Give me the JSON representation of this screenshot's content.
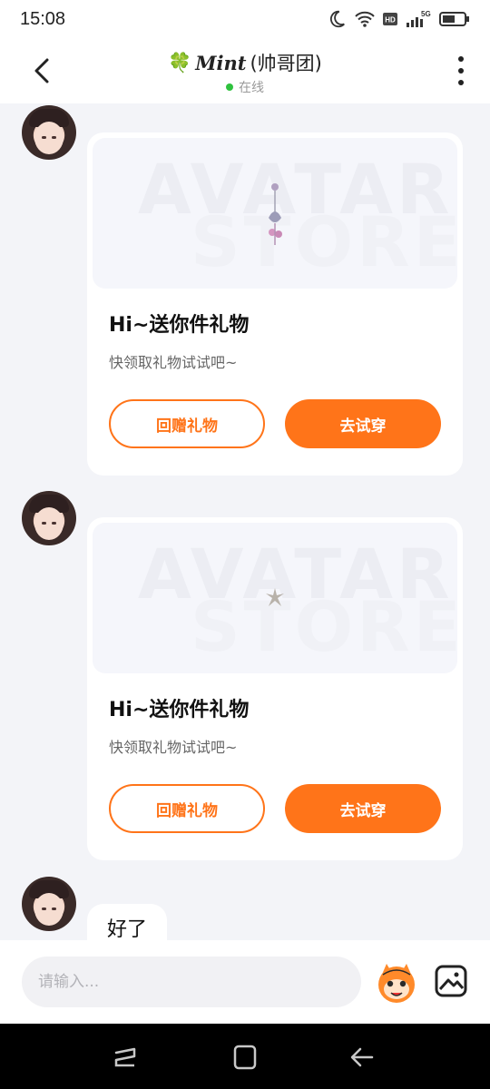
{
  "status_bar": {
    "time": "15:08",
    "icons": [
      "moon-icon",
      "wifi-icon",
      "hd-icon",
      "signal-5g-icon",
      "battery-icon"
    ]
  },
  "header": {
    "title_prefix": "🍀",
    "title_name": "Mint",
    "title_group": "(帅哥团)",
    "status": "在线",
    "status_color": "#2fc23e"
  },
  "messages": [
    {
      "type": "gift_card",
      "banner_word_1": "AVATAR",
      "banner_word_2": "STORE",
      "title": "Hi~送你件礼物",
      "subtitle": "快领取礼物试试吧~",
      "return_label": "回赠礼物",
      "try_label": "去试穿"
    },
    {
      "type": "gift_card",
      "banner_word_1": "AVATAR",
      "banner_word_2": "STORE",
      "title": "Hi~送你件礼物",
      "subtitle": "快领取礼物试试吧~",
      "return_label": "回赠礼物",
      "try_label": "去试穿"
    },
    {
      "type": "text",
      "text": "好了"
    }
  ],
  "input": {
    "placeholder": "请输入...",
    "value": ""
  },
  "colors": {
    "accent": "#ff7419",
    "background": "#f3f4f8"
  },
  "nav_bar": {
    "icons": [
      "recent-apps-icon",
      "home-icon",
      "back-icon"
    ]
  }
}
